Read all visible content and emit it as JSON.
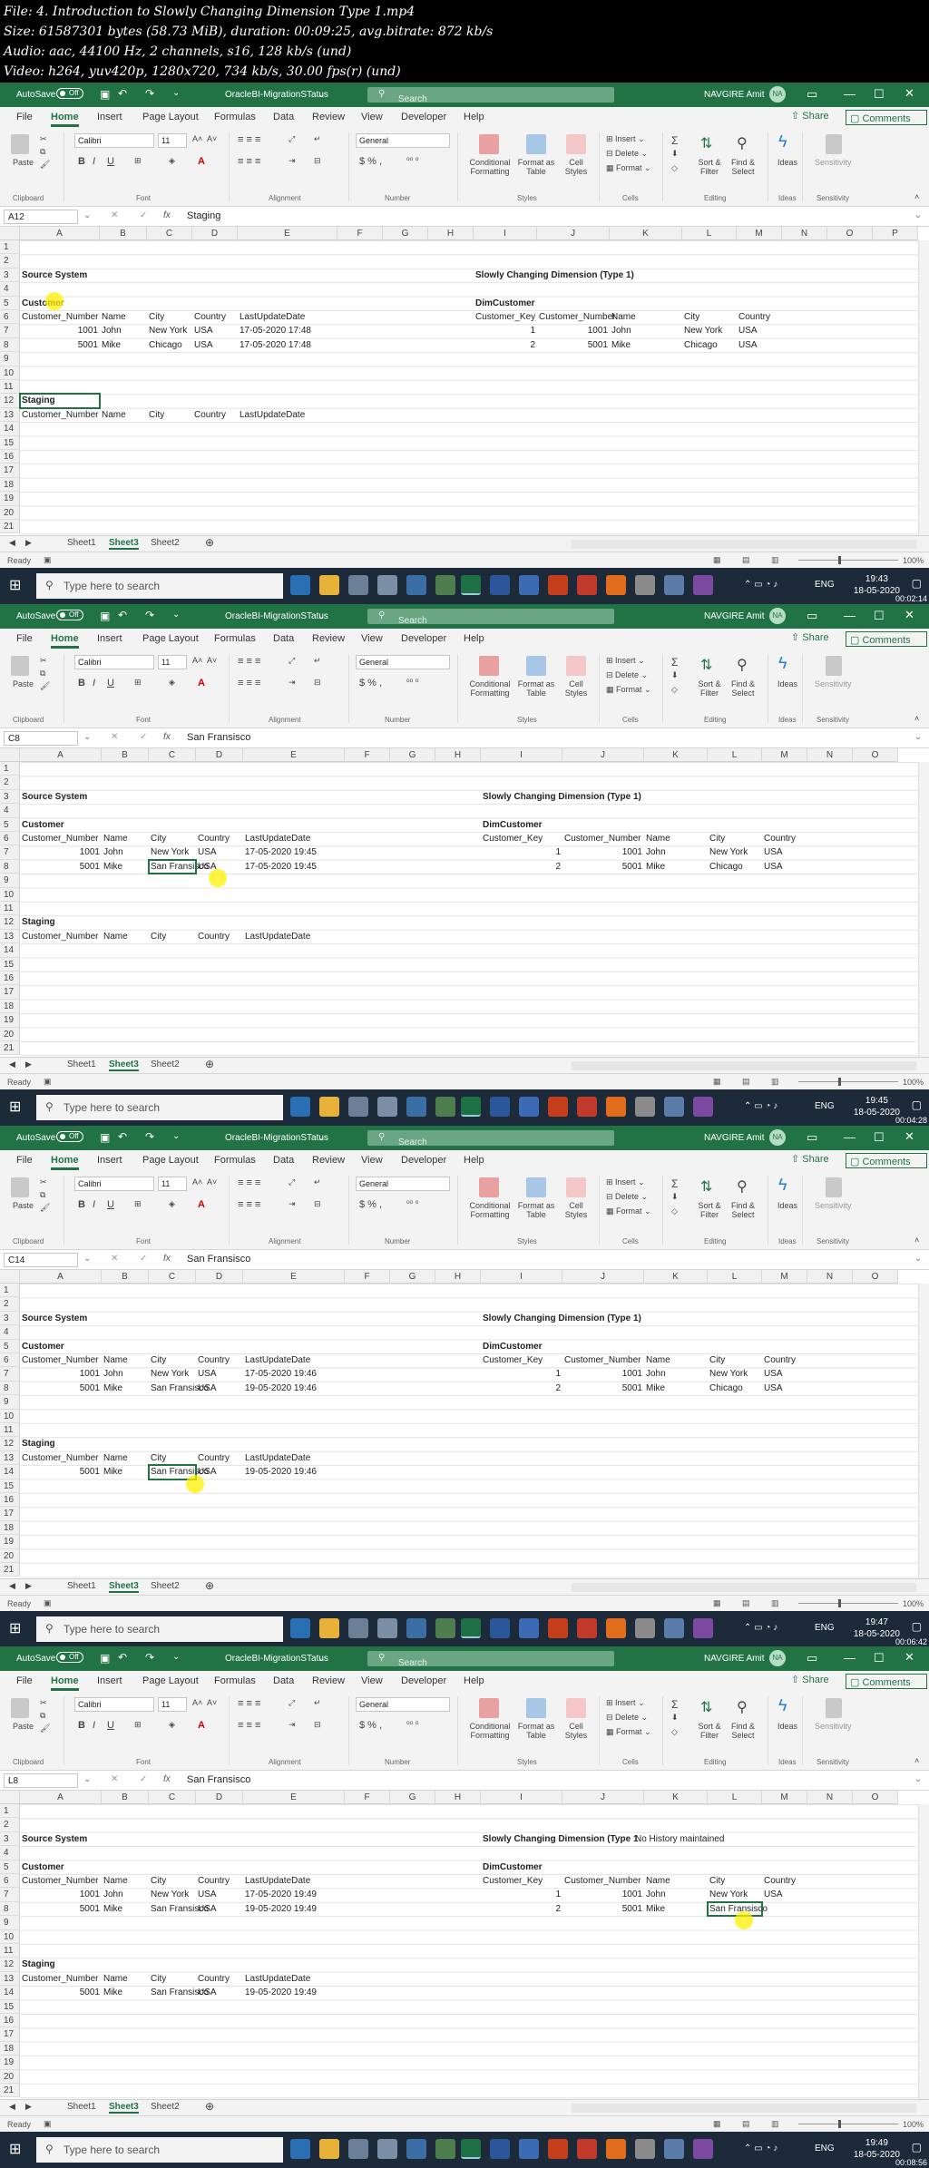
{
  "file_info": [
    "File: 4. Introduction to Slowly Changing Dimension Type 1.mp4",
    "Size: 61587301 bytes (58.73 MiB), duration: 00:09:25, avg.bitrate: 872 kb/s",
    "Audio: aac, 44100 Hz, 2 channels, s16, 128 kb/s (und)",
    "Video: h264, yuv420p, 1280x720, 734 kb/s, 30.00 fps(r) (und)"
  ],
  "app": {
    "autosave": "AutoSave",
    "autosave_state": "Off",
    "title": "OracleBI-MigrationSTatus",
    "search": "Search",
    "user": "NAVGIRE Amit",
    "initials": "NA",
    "tabs": [
      "File",
      "Home",
      "Insert",
      "Page Layout",
      "Formulas",
      "Data",
      "Review",
      "View",
      "Developer",
      "Help"
    ],
    "share": "Share",
    "comments": "Comments",
    "font_name": "Calibri",
    "font_size": "11",
    "number_format": "General",
    "groups": [
      "Clipboard",
      "Font",
      "Alignment",
      "Number",
      "Styles",
      "Cells",
      "Editing",
      "Ideas",
      "Sensitivity"
    ],
    "ribbon_labels": {
      "paste": "Paste",
      "cond": "Conditional Formatting",
      "table": "Format as Table",
      "cellstyles": "Cell Styles",
      "insert": "Insert",
      "delete": "Delete",
      "format": "Format",
      "sort": "Sort & Filter",
      "find": "Find & Select",
      "ideas": "Ideas",
      "sensitivity": "Sensitivity"
    },
    "fx": "fx",
    "sheets": [
      "Sheet1",
      "Sheet3",
      "Sheet2"
    ],
    "status_ready": "Ready",
    "zoom": "100%",
    "taskbar_search": "Type here to search",
    "lang": "ENG"
  },
  "frames": [
    {
      "namebox": "A12",
      "formula": "Staging",
      "time": "19:43",
      "date": "18-05-2020",
      "timestamp": "00:02:14",
      "columns": [
        "A",
        "B",
        "C",
        "D",
        "E",
        "F",
        "G",
        "H",
        "I",
        "J",
        "K",
        "L",
        "M",
        "N",
        "O",
        "P"
      ],
      "cells": {
        "r3a": "Source System",
        "r3i": "Slowly Changing Dimension (Type 1)",
        "r5a": "Customer",
        "r5i": "DimCustomer",
        "r6a": "Customer_Number",
        "r6b": "Name",
        "r6c": "City",
        "r6d": "Country",
        "r6e": "LastUpdateDate",
        "r6i": "Customer_Key",
        "r6j": "Customer_Number",
        "r6k": "Name",
        "r6l": "City",
        "r6m": "Country",
        "r7a": "1001",
        "r7b": "John",
        "r7c": "New York",
        "r7d": "USA",
        "r7e": "17-05-2020 17:48",
        "r7i": "1",
        "r7j": "1001",
        "r7k": "John",
        "r7l": "New York",
        "r7m": "USA",
        "r8a": "5001",
        "r8b": "Mike",
        "r8c": "Chicago",
        "r8d": "USA",
        "r8e": "17-05-2020 17:48",
        "r8i": "2",
        "r8j": "5001",
        "r8k": "Mike",
        "r8l": "Chicago",
        "r8m": "USA",
        "r12a": "Staging",
        "r13a": "Customer_Number",
        "r13b": "Name",
        "r13c": "City",
        "r13d": "Country",
        "r13e": "LastUpdateDate",
        "r14a": "",
        "r14b": "",
        "r14c": "",
        "r14d": "",
        "r14e": ""
      },
      "extra": ""
    },
    {
      "namebox": "C8",
      "formula": "San Fransisco",
      "time": "19:45",
      "date": "18-05-2020",
      "timestamp": "00:04:28",
      "columns": [
        "A",
        "B",
        "C",
        "D",
        "E",
        "F",
        "G",
        "H",
        "I",
        "J",
        "K",
        "L",
        "M",
        "N",
        "O"
      ],
      "cells": {
        "r3a": "Source System",
        "r3i": "Slowly Changing Dimension (Type 1)",
        "r5a": "Customer",
        "r5i": "DimCustomer",
        "r6a": "Customer_Number",
        "r6b": "Name",
        "r6c": "City",
        "r6d": "Country",
        "r6e": "LastUpdateDate",
        "r6i": "Customer_Key",
        "r6j": "Customer_Number",
        "r6k": "Name",
        "r6l": "City",
        "r6m": "Country",
        "r7a": "1001",
        "r7b": "John",
        "r7c": "New York",
        "r7d": "USA",
        "r7e": "17-05-2020 19:45",
        "r7i": "1",
        "r7j": "1001",
        "r7k": "John",
        "r7l": "New York",
        "r7m": "USA",
        "r8a": "5001",
        "r8b": "Mike",
        "r8c": "San Fransisco",
        "r8d": "USA",
        "r8e": "17-05-2020 19:45",
        "r8i": "2",
        "r8j": "5001",
        "r8k": "Mike",
        "r8l": "Chicago",
        "r8m": "USA",
        "r12a": "Staging",
        "r13a": "Customer_Number",
        "r13b": "Name",
        "r13c": "City",
        "r13d": "Country",
        "r13e": "LastUpdateDate",
        "r14a": "",
        "r14b": "",
        "r14c": "",
        "r14d": "",
        "r14e": ""
      },
      "extra": ""
    },
    {
      "namebox": "C14",
      "formula": "San Fransisco",
      "time": "19:47",
      "date": "18-05-2020",
      "timestamp": "00:06:42",
      "columns": [
        "A",
        "B",
        "C",
        "D",
        "E",
        "F",
        "G",
        "H",
        "I",
        "J",
        "K",
        "L",
        "M",
        "N",
        "O"
      ],
      "cells": {
        "r3a": "Source System",
        "r3i": "Slowly Changing Dimension (Type 1)",
        "r5a": "Customer",
        "r5i": "DimCustomer",
        "r6a": "Customer_Number",
        "r6b": "Name",
        "r6c": "City",
        "r6d": "Country",
        "r6e": "LastUpdateDate",
        "r6i": "Customer_Key",
        "r6j": "Customer_Number",
        "r6k": "Name",
        "r6l": "City",
        "r6m": "Country",
        "r7a": "1001",
        "r7b": "John",
        "r7c": "New York",
        "r7d": "USA",
        "r7e": "17-05-2020 19:46",
        "r7i": "1",
        "r7j": "1001",
        "r7k": "John",
        "r7l": "New York",
        "r7m": "USA",
        "r8a": "5001",
        "r8b": "Mike",
        "r8c": "San Fransisco",
        "r8d": "USA",
        "r8e": "19-05-2020 19:46",
        "r8i": "2",
        "r8j": "5001",
        "r8k": "Mike",
        "r8l": "Chicago",
        "r8m": "USA",
        "r12a": "Staging",
        "r13a": "Customer_Number",
        "r13b": "Name",
        "r13c": "City",
        "r13d": "Country",
        "r13e": "LastUpdateDate",
        "r14a": "5001",
        "r14b": "Mike",
        "r14c": "San Fransisco",
        "r14d": "USA",
        "r14e": "19-05-2020 19:46"
      },
      "extra": ""
    },
    {
      "namebox": "L8",
      "formula": "San Fransisco",
      "time": "19:49",
      "date": "18-05-2020",
      "timestamp": "00:08:56",
      "columns": [
        "A",
        "B",
        "C",
        "D",
        "E",
        "F",
        "G",
        "H",
        "I",
        "J",
        "K",
        "L",
        "M",
        "N",
        "O"
      ],
      "cells": {
        "r3a": "Source System",
        "r3i": "Slowly Changing Dimension (Type 1",
        "r5a": "Customer",
        "r5i": "DimCustomer",
        "r6a": "Customer_Number",
        "r6b": "Name",
        "r6c": "City",
        "r6d": "Country",
        "r6e": "LastUpdateDate",
        "r6i": "Customer_Key",
        "r6j": "Customer_Number",
        "r6k": "Name",
        "r6l": "City",
        "r6m": "Country",
        "r7a": "1001",
        "r7b": "John",
        "r7c": "New York",
        "r7d": "USA",
        "r7e": "17-05-2020 19:49",
        "r7i": "1",
        "r7j": "1001",
        "r7k": "John",
        "r7l": "New York",
        "r7m": "USA",
        "r8a": "5001",
        "r8b": "Mike",
        "r8c": "San Fransisco",
        "r8d": "USA",
        "r8e": "19-05-2020 19:49",
        "r8i": "2",
        "r8j": "5001",
        "r8k": "Mike",
        "r8l": "San Fransisco",
        "r8m": "",
        "r12a": "Staging",
        "r13a": "Customer_Number",
        "r13b": "Name",
        "r13c": "City",
        "r13d": "Country",
        "r13e": "LastUpdateDate",
        "r14a": "5001",
        "r14b": "Mike",
        "r14c": "San Fransisco",
        "r14d": "USA",
        "r14e": "19-05-2020 19:49"
      },
      "extra": "No History maintained"
    }
  ]
}
